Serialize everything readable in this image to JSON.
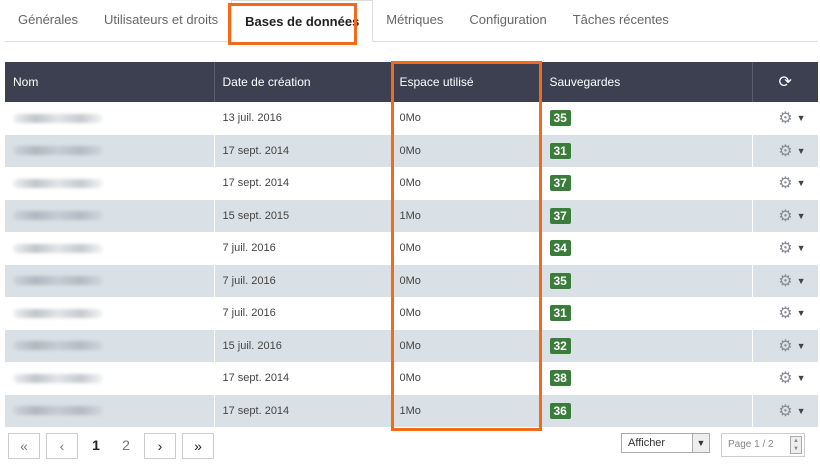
{
  "tabs": [
    {
      "label": "Générales"
    },
    {
      "label": "Utilisateurs et droits"
    },
    {
      "label": "Bases de données"
    },
    {
      "label": "Métriques"
    },
    {
      "label": "Configuration"
    },
    {
      "label": "Tâches récentes"
    }
  ],
  "active_tab": "Bases de données",
  "table": {
    "headers": {
      "name": "Nom",
      "created": "Date de création",
      "space": "Espace utilisé",
      "backups": "Sauvegardes",
      "refresh_icon": "refresh-icon"
    },
    "rows": [
      {
        "date": "13 juil. 2016",
        "space": "0Mo",
        "backups": "35"
      },
      {
        "date": "17 sept. 2014",
        "space": "0Mo",
        "backups": "31"
      },
      {
        "date": "17 sept. 2014",
        "space": "0Mo",
        "backups": "37"
      },
      {
        "date": "15 sept. 2015",
        "space": "1Mo",
        "backups": "37"
      },
      {
        "date": "7 juil. 2016",
        "space": "0Mo",
        "backups": "34"
      },
      {
        "date": "7 juil. 2016",
        "space": "0Mo",
        "backups": "35"
      },
      {
        "date": "7 juil. 2016",
        "space": "0Mo",
        "backups": "31"
      },
      {
        "date": "15 juil. 2016",
        "space": "0Mo",
        "backups": "32"
      },
      {
        "date": "17 sept. 2014",
        "space": "0Mo",
        "backups": "38"
      },
      {
        "date": "17 sept. 2014",
        "space": "1Mo",
        "backups": "36"
      }
    ]
  },
  "pagination": {
    "first": "«",
    "prev": "‹",
    "pages": [
      "1",
      "2"
    ],
    "current": "1",
    "next": "›",
    "last": "»",
    "show_label": "Afficher",
    "page_indicator": "Page 1 / 2"
  },
  "colors": {
    "header_bg": "#3d4050",
    "highlight": "#f26a1b",
    "badge": "#3a7d3a",
    "row_alt": "#d9e1e6"
  }
}
